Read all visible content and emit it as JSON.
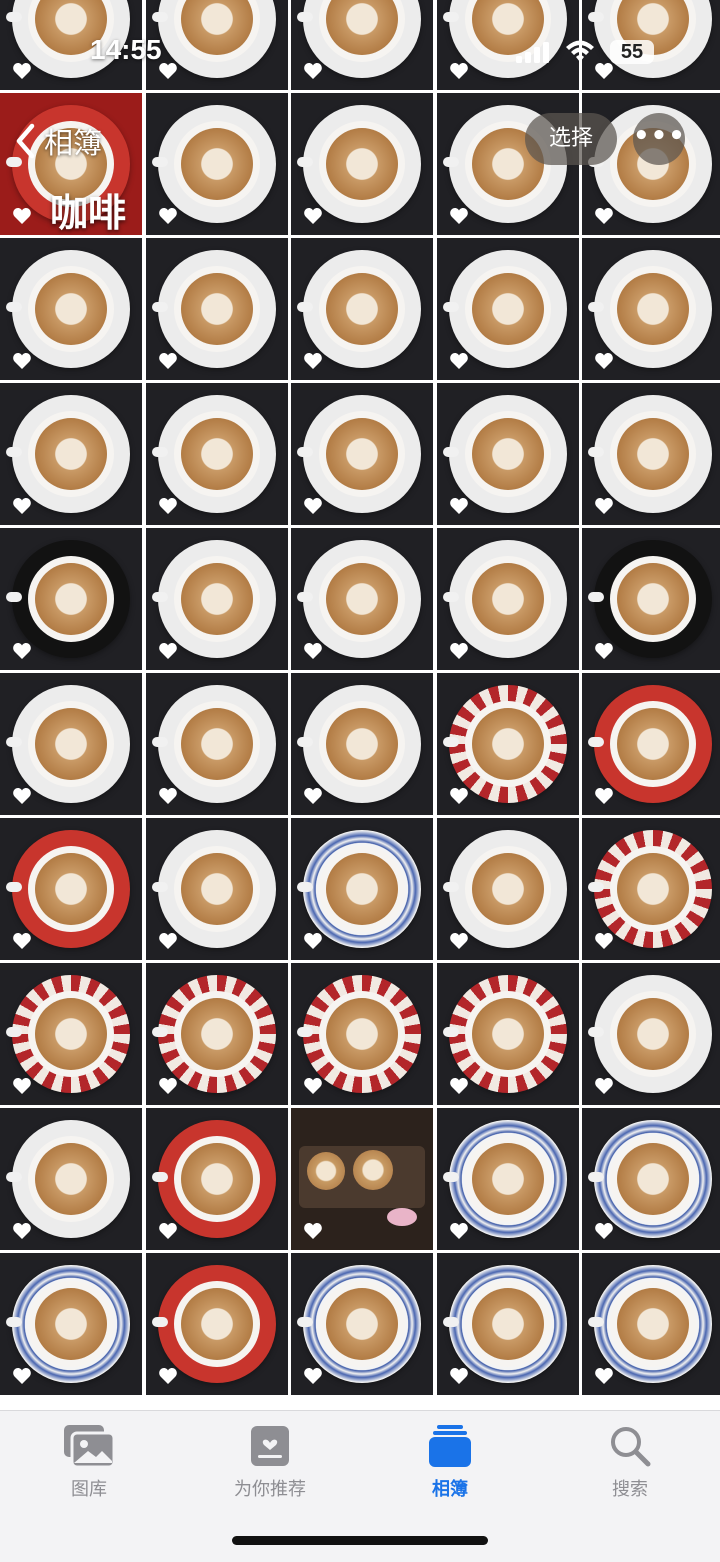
{
  "status_bar": {
    "time": "14:55",
    "battery": "55"
  },
  "header": {
    "back_label": "相簿",
    "album_title": "咖啡",
    "select_label": "选择",
    "more_label": "•••"
  },
  "tabs": [
    {
      "label": "图库",
      "icon": "photo-library-icon"
    },
    {
      "label": "为你推荐",
      "icon": "for-you-icon"
    },
    {
      "label": "相簿",
      "icon": "albums-icon"
    },
    {
      "label": "搜索",
      "icon": "search-icon"
    }
  ],
  "active_tab": "相簿",
  "colors": {
    "accent": "#1a73e8",
    "tab_inactive": "#8e8e93"
  },
  "photos": [
    {
      "bg": "dark",
      "saucer": "white"
    },
    {
      "bg": "dark",
      "saucer": "white"
    },
    {
      "bg": "dark",
      "saucer": "white"
    },
    {
      "bg": "dark",
      "saucer": "white"
    },
    {
      "bg": "dark",
      "saucer": "white"
    },
    {
      "bg": "red",
      "saucer": "red"
    },
    {
      "bg": "dark",
      "saucer": "white"
    },
    {
      "bg": "dark",
      "saucer": "white"
    },
    {
      "bg": "dark",
      "saucer": "white"
    },
    {
      "bg": "dark",
      "saucer": "white"
    },
    {
      "bg": "dark",
      "saucer": "white"
    },
    {
      "bg": "dark",
      "saucer": "white"
    },
    {
      "bg": "dark",
      "saucer": "white"
    },
    {
      "bg": "dark",
      "saucer": "white"
    },
    {
      "bg": "dark",
      "saucer": "white"
    },
    {
      "bg": "dark",
      "saucer": "white"
    },
    {
      "bg": "dark",
      "saucer": "white"
    },
    {
      "bg": "dark",
      "saucer": "white"
    },
    {
      "bg": "dark",
      "saucer": "white"
    },
    {
      "bg": "dark",
      "saucer": "white"
    },
    {
      "bg": "dark",
      "saucer": "black"
    },
    {
      "bg": "dark",
      "saucer": "white"
    },
    {
      "bg": "dark",
      "saucer": "white"
    },
    {
      "bg": "dark",
      "saucer": "white"
    },
    {
      "bg": "dark",
      "saucer": "black"
    },
    {
      "bg": "dark",
      "saucer": "white"
    },
    {
      "bg": "dark",
      "saucer": "white"
    },
    {
      "bg": "dark",
      "saucer": "white"
    },
    {
      "bg": "dark",
      "saucer": "pattern"
    },
    {
      "bg": "dark",
      "saucer": "red"
    },
    {
      "bg": "dark",
      "saucer": "red"
    },
    {
      "bg": "dark",
      "saucer": "white"
    },
    {
      "bg": "dark",
      "saucer": "blue"
    },
    {
      "bg": "dark",
      "saucer": "white"
    },
    {
      "bg": "dark",
      "saucer": "pattern"
    },
    {
      "bg": "dark",
      "saucer": "pattern"
    },
    {
      "bg": "dark",
      "saucer": "pattern"
    },
    {
      "bg": "dark",
      "saucer": "pattern"
    },
    {
      "bg": "dark",
      "saucer": "pattern"
    },
    {
      "bg": "dark",
      "saucer": "white"
    },
    {
      "bg": "dark",
      "saucer": "white"
    },
    {
      "bg": "dark",
      "saucer": "red"
    },
    {
      "bg": "brown",
      "saucer": "none"
    },
    {
      "bg": "dark",
      "saucer": "blue"
    },
    {
      "bg": "dark",
      "saucer": "blue"
    },
    {
      "bg": "dark",
      "saucer": "blue"
    },
    {
      "bg": "dark",
      "saucer": "red"
    },
    {
      "bg": "dark",
      "saucer": "blue"
    },
    {
      "bg": "dark",
      "saucer": "blue"
    },
    {
      "bg": "dark",
      "saucer": "blue"
    }
  ]
}
